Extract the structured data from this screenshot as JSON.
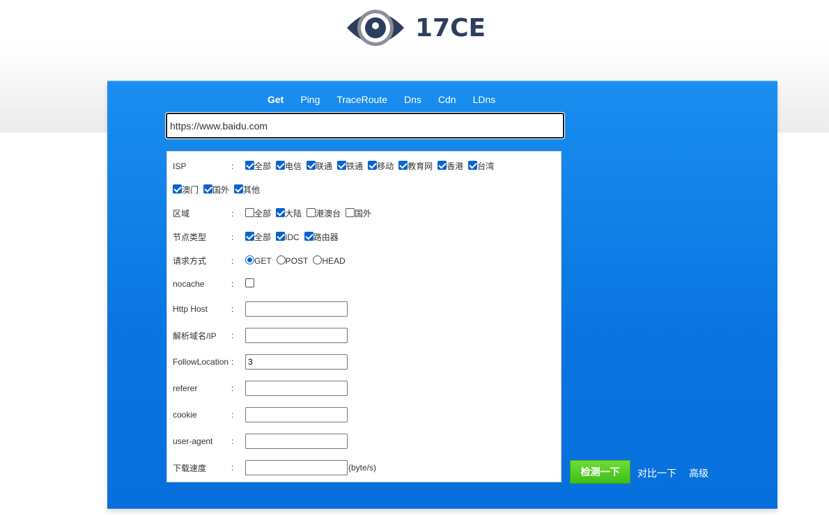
{
  "header": {
    "logo_text": "17CE",
    "colors": {
      "logo_dark": "#2d3e5e",
      "logo_ring": "#8a8f98"
    }
  },
  "panel": {
    "color": "#0a74e0"
  },
  "tabs": [
    {
      "label": "Get",
      "active": true
    },
    {
      "label": "Ping",
      "active": false
    },
    {
      "label": "TraceRoute",
      "active": false
    },
    {
      "label": "Dns",
      "active": false
    },
    {
      "label": "Cdn",
      "active": false
    },
    {
      "label": "LDns",
      "active": false
    }
  ],
  "url_input": {
    "value": "https://www.baidu.com"
  },
  "form": {
    "isp": {
      "label": "ISP",
      "colon": ":",
      "options": [
        {
          "label": "全部",
          "checked": true
        },
        {
          "label": "电信",
          "checked": true
        },
        {
          "label": "联通",
          "checked": true
        },
        {
          "label": "铁通",
          "checked": true
        },
        {
          "label": "移动",
          "checked": true
        },
        {
          "label": "教育网",
          "checked": true
        },
        {
          "label": "香港",
          "checked": true
        },
        {
          "label": "台湾",
          "checked": true
        },
        {
          "label": "澳门",
          "checked": true
        },
        {
          "label": "国外",
          "checked": true
        },
        {
          "label": "其他",
          "checked": true
        }
      ]
    },
    "region": {
      "label": "区域",
      "colon": ":",
      "options": [
        {
          "label": "全部",
          "checked": false
        },
        {
          "label": "大陆",
          "checked": true
        },
        {
          "label": "港澳台",
          "checked": false
        },
        {
          "label": "国外",
          "checked": false
        }
      ]
    },
    "node_type": {
      "label": "节点类型",
      "colon": ":",
      "options": [
        {
          "label": "全部",
          "checked": true
        },
        {
          "label": "IDC",
          "checked": true
        },
        {
          "label": "路由器",
          "checked": true
        }
      ]
    },
    "method": {
      "label": "请求方式",
      "colon": ":",
      "options": [
        {
          "label": "GET",
          "checked": true
        },
        {
          "label": "POST",
          "checked": false
        },
        {
          "label": "HEAD",
          "checked": false
        }
      ]
    },
    "nocache": {
      "label": "nocache",
      "colon": ":",
      "checked": false
    },
    "http_host": {
      "label": "Http Host",
      "colon": ":",
      "value": ""
    },
    "resolve": {
      "label": "解析域名/IP",
      "colon": ":",
      "value": ""
    },
    "follow_location": {
      "label": "FollowLocation",
      "colon": ":",
      "value": "3"
    },
    "referer": {
      "label": "referer",
      "colon": ":",
      "value": ""
    },
    "cookie": {
      "label": "cookie",
      "colon": ":",
      "value": ""
    },
    "user_agent": {
      "label": "user-agent",
      "colon": ":",
      "value": ""
    },
    "download_speed": {
      "label": "下载速度",
      "colon": ":",
      "value": "",
      "unit": "(byte/s)"
    }
  },
  "actions": {
    "check_label": "检测一下",
    "compare_label": "对比一下",
    "advanced_label": "高级",
    "check_color": "#3fbf18"
  }
}
